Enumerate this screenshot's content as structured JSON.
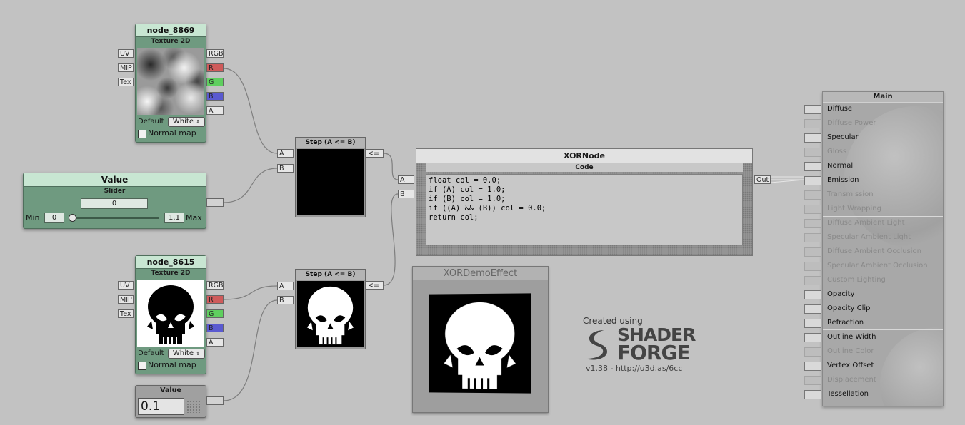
{
  "node_8869": {
    "title": "node_8869",
    "subtitle": "Texture 2D",
    "inputs": [
      "UV",
      "MIP",
      "Tex"
    ],
    "outputs": [
      "RGB",
      "R",
      "G",
      "B",
      "A"
    ],
    "default_label": "Default",
    "default_value": "White",
    "normal_map_label": "Normal map",
    "preview": "cloud-noise-texture"
  },
  "value_slider": {
    "title": "Value",
    "subtitle": "Slider",
    "value": "0",
    "min_label": "Min",
    "min_value": "0",
    "max_value": "1.1",
    "max_label": "Max",
    "slider_fraction": 0.0
  },
  "node_8615": {
    "title": "node_8615",
    "subtitle": "Texture 2D",
    "inputs": [
      "UV",
      "MIP",
      "Tex"
    ],
    "outputs": [
      "RGB",
      "R",
      "G",
      "B",
      "A"
    ],
    "default_label": "Default",
    "default_value": "White",
    "normal_map_label": "Normal map",
    "preview": "black-skull-on-white"
  },
  "value_node": {
    "title": "Value",
    "value": "0.1"
  },
  "step_top": {
    "title": "Step (A <= B)",
    "inputs": [
      "A",
      "B"
    ],
    "output": "<="
  },
  "step_bottom": {
    "title": "Step (A <= B)",
    "inputs": [
      "A",
      "B"
    ],
    "output": "<="
  },
  "xor_node": {
    "title": "XORNode",
    "section": "Code",
    "inputs": [
      "A",
      "B"
    ],
    "output": "Out",
    "code": "float col = 0.0;\nif (A) col = 1.0;\nif (B) col = 1.0;\nif ((A) && (B)) col = 0.0;\nreturn col;"
  },
  "preview_panel": {
    "title": "XORDemoEffect"
  },
  "branding": {
    "created_using": "Created using",
    "logo_line1": "SHADER",
    "logo_line2": "FORGE",
    "version": "v1.38 - http://u3d.as/6cc"
  },
  "main_panel": {
    "title": "Main",
    "items": [
      {
        "label": "Diffuse",
        "enabled": true
      },
      {
        "label": "Diffuse Power",
        "enabled": false
      },
      {
        "label": "Specular",
        "enabled": true
      },
      {
        "label": "Gloss",
        "enabled": false
      },
      {
        "label": "Normal",
        "enabled": true
      },
      {
        "label": "Emission",
        "enabled": true
      },
      {
        "label": "Transmission",
        "enabled": false
      },
      {
        "label": "Light Wrapping",
        "enabled": false
      },
      {
        "label": "Diffuse Ambient Light",
        "enabled": false
      },
      {
        "label": "Specular Ambient Light",
        "enabled": false
      },
      {
        "label": "Diffuse Ambient Occlusion",
        "enabled": false
      },
      {
        "label": "Specular Ambient Occlusion",
        "enabled": false
      },
      {
        "label": "Custom Lighting",
        "enabled": false
      },
      {
        "label": "Opacity",
        "enabled": true
      },
      {
        "label": "Opacity Clip",
        "enabled": true
      },
      {
        "label": "Refraction",
        "enabled": true
      },
      {
        "label": "Outline Width",
        "enabled": true
      },
      {
        "label": "Outline Color",
        "enabled": false
      },
      {
        "label": "Vertex Offset",
        "enabled": true
      },
      {
        "label": "Displacement",
        "enabled": false
      },
      {
        "label": "Tessellation",
        "enabled": true
      }
    ]
  },
  "colors": {
    "canvas": "#c2c2c2",
    "node_green": "#6f9a80",
    "node_header": "#c8e6d2",
    "port_r": "#cf5b5b",
    "port_g": "#5fcf5f",
    "port_b": "#5a5ad0"
  }
}
